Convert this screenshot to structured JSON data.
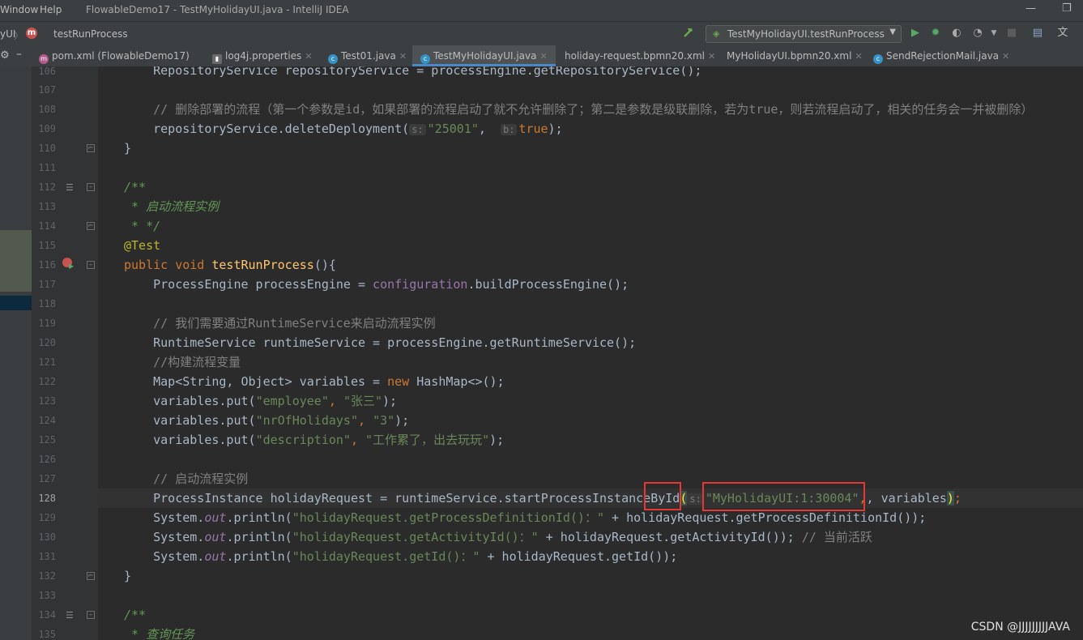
{
  "menubar": {
    "items": [
      "Window",
      "Help"
    ],
    "title": "FlowableDemo17 - TestMyHolidayUI.java - IntelliJ IDEA",
    "controls": {
      "minimize": "—",
      "restore": "❐"
    }
  },
  "navbar": {
    "crumb_project": "yUI",
    "crumb_sep": "〉",
    "module_badge": "m",
    "crumb_method": "testRunProcess",
    "run_config": "TestMyHolidayUI.testRunProcess"
  },
  "tabs": [
    {
      "label": "pom.xml (FlowableDemo17)",
      "icon": "maven-icon",
      "active": false
    },
    {
      "label": "log4j.properties",
      "icon": "properties-icon",
      "active": false
    },
    {
      "label": "Test01.java",
      "icon": "java-class-icon",
      "active": false
    },
    {
      "label": "TestMyHolidayUI.java",
      "icon": "java-class-icon",
      "active": true
    },
    {
      "label": "holiday-request.bpmn20.xml",
      "icon": "xml-icon",
      "active": false
    },
    {
      "label": "MyHolidayUI.bpmn20.xml",
      "icon": "xml-icon",
      "active": false
    },
    {
      "label": "SendRejectionMail.java",
      "icon": "java-class-icon",
      "active": false
    }
  ],
  "editor": {
    "line_numbers": [
      "106",
      "107",
      "108",
      "109",
      "110",
      "111",
      "112",
      "113",
      "114",
      "115",
      "116",
      "117",
      "118",
      "119",
      "120",
      "121",
      "122",
      "123",
      "124",
      "125",
      "126",
      "127",
      "128",
      "129",
      "130",
      "131",
      "132",
      "133",
      "134",
      "135"
    ],
    "current_line": "128",
    "hints": {
      "s": "s:",
      "b": "b:"
    },
    "code": {
      "l106": "    RepositoryService repositoryService = processEngine.getRepositoryService();",
      "l108": "    // 删除部署的流程（第一个参数是id，如果部署的流程启动了就不允许删除了；第二是参数是级联删除，若为true，则若流程启动了，相关的任务会一并被删除）",
      "l109_pre": "    repositoryService.deleteDeployment(",
      "l109_arg1": "\"25001\"",
      "l109_arg2": "true",
      "l109_post": ");",
      "l110": "}",
      "l112": "/**",
      "l113": " * 启动流程实例",
      "l114": " * */",
      "l115": "@Test",
      "l116_kw1": "public",
      "l116_kw2": "void",
      "l116_fn": "testRunProcess",
      "l116_post": "(){",
      "l117_pre": "    ProcessEngine processEngine = ",
      "l117_field": "configuration",
      "l117_post": ".buildProcessEngine();",
      "l119": "    // 我们需要通过RuntimeService来启动流程实例",
      "l120": "    RuntimeService runtimeService = processEngine.getRuntimeService();",
      "l121": "    //构建流程变量",
      "l122_pre": "    Map<String, Object> variables = ",
      "l122_kw": "new",
      "l122_post": " HashMap<>();",
      "l123_pre": "    variables.put(",
      "l123_a": "\"employee\"",
      "l123_b": "\"张三\"",
      "l124_pre": "    variables.put(",
      "l124_a": "\"nrOfHolidays\"",
      "l124_b": "\"3\"",
      "l125_pre": "    variables.put(",
      "l125_a": "\"description\"",
      "l125_b": "\"工作累了，出去玩玩\"",
      "l127": "    // 启动流程实例",
      "l128_pre": "    ProcessInstance holidayRequest = runtimeService.startProcessInstance",
      "l128_hl": "ById",
      "l128_arg": "\"MyHolidayUI:1:30004\"",
      "l128_post": ", variables",
      "l129_pre": "    System.",
      "l129_out": "out",
      "l129_mid": ".println(",
      "l129_str": "\"holidayRequest.getProcessDefinitionId()：\"",
      "l129_post": " + holidayRequest.getProcessDefinitionId());",
      "l130_pre": "    System.",
      "l130_out": "out",
      "l130_mid": ".println(",
      "l130_str": "\"holidayRequest.getActivityId()：\"",
      "l130_post": " + holidayRequest.getActivityId()); ",
      "l130_cm": "// 当前活跃",
      "l131_pre": "    System.",
      "l131_out": "out",
      "l131_mid": ".println(",
      "l131_str": "\"holidayRequest.getId()：\"",
      "l131_post": " + holidayRequest.getId());",
      "l132": "}",
      "l134": "/**",
      "l135": " * 查询任务"
    }
  },
  "watermark": "CSDN @JJJJJJJJJAVA",
  "colors": {
    "keyword": "#cc7832",
    "string": "#6a8759",
    "comment": "#808080",
    "highlight_box": "#e53935",
    "active_tab_underline": "#4a88c7"
  }
}
